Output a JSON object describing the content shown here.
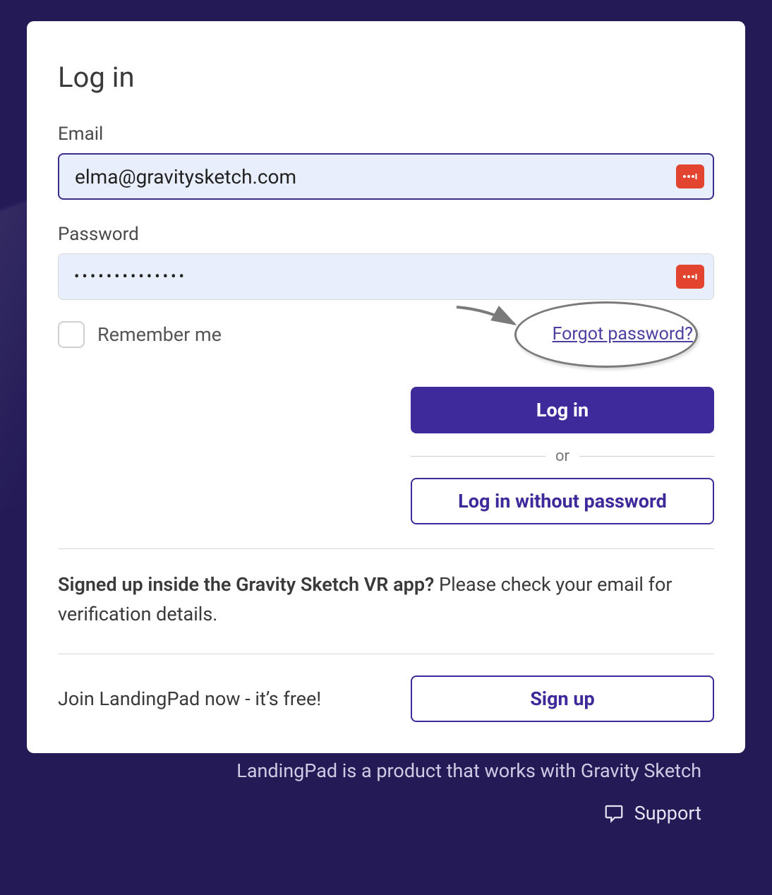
{
  "title": "Log in",
  "email": {
    "label": "Email",
    "value": "elma@gravitysketch.com"
  },
  "password": {
    "label": "Password",
    "value": "••••••••••••••"
  },
  "remember": {
    "label": "Remember me",
    "checked": false
  },
  "forgot_link": "Forgot password?",
  "buttons": {
    "login": "Log in",
    "or": "or",
    "login_no_password": "Log in without password",
    "signup": "Sign up"
  },
  "vr_notice": {
    "bold": "Signed up inside the Gravity Sketch VR app?",
    "rest": " Please check your email for verification details."
  },
  "signup_prompt": "Join LandingPad now - it’s free!",
  "footer_tagline": "LandingPad is a product that works with Gravity Sketch",
  "support_label": "Support"
}
